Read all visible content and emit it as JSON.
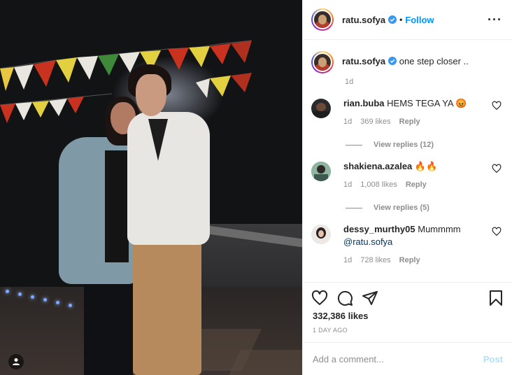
{
  "post": {
    "author": "ratu.sofya",
    "follow_label": "Follow",
    "separator": "•",
    "more_icon": "more-horizontal-icon",
    "caption_text": "one step closer ..",
    "caption_time": "1d",
    "likes": "332,386 likes",
    "date": "1 DAY AGO"
  },
  "comments": [
    {
      "user": "rian.buba",
      "text": "HEMS TEGA YA 😡",
      "time": "1d",
      "likes": "369 likes",
      "reply": "Reply",
      "view_replies": "View replies (12)",
      "avatar_color": "#2b2a2a"
    },
    {
      "user": "shakiena.azalea",
      "text": "🔥🔥",
      "time": "1d",
      "likes": "1,008 likes",
      "reply": "Reply",
      "view_replies": "View replies (5)",
      "avatar_color": "#6b8f7a"
    },
    {
      "user": "dessy_murthy05",
      "text": "Mummmm",
      "mention": "@ratu.sofya",
      "time": "1d",
      "likes": "728 likes",
      "reply": "Reply",
      "avatar_color": "#d9d2cf"
    }
  ],
  "composer": {
    "placeholder": "Add a comment...",
    "post_label": "Post"
  },
  "colors": {
    "link_blue": "#0095f6",
    "muted": "#8e8e8e",
    "post_disabled": "#b2dffc"
  }
}
